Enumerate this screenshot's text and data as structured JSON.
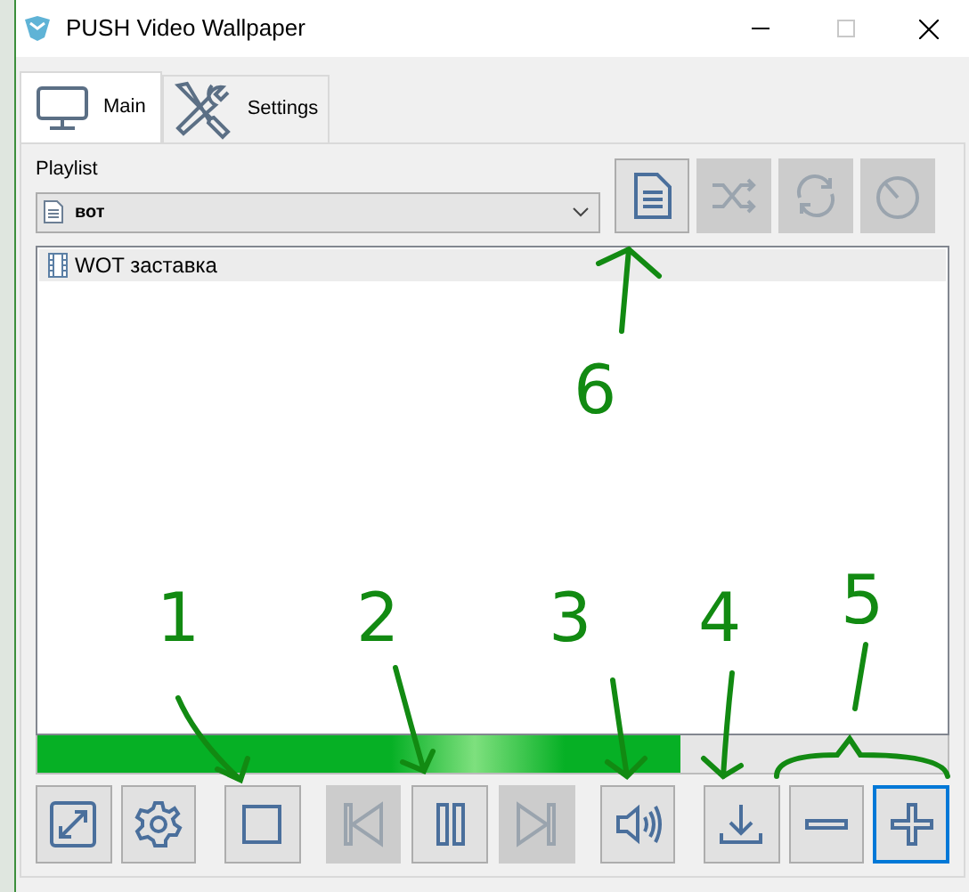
{
  "window": {
    "title": "PUSH Video Wallpaper"
  },
  "tabs": [
    {
      "label": "Main",
      "selected": true
    },
    {
      "label": "Settings",
      "selected": false
    }
  ],
  "playlist": {
    "label": "Playlist",
    "value": "вот"
  },
  "playlist_buttons": [
    {
      "disabled": false
    },
    {
      "disabled": true
    },
    {
      "disabled": true
    },
    {
      "disabled": true
    }
  ],
  "videos": [
    {
      "name": "WOT заставка",
      "selected": true
    }
  ],
  "progress": {
    "level": 0.706
  },
  "controls": [
    {
      "disabled": false,
      "focused": false
    },
    {
      "disabled": false,
      "focused": false
    },
    {
      "disabled": false,
      "focused": false
    },
    {
      "disabled": true,
      "focused": false
    },
    {
      "disabled": false,
      "focused": false
    },
    {
      "disabled": true,
      "focused": false
    },
    {
      "disabled": false,
      "focused": false
    },
    {
      "disabled": false,
      "focused": false
    },
    {
      "disabled": false,
      "focused": false
    },
    {
      "disabled": false,
      "focused": true
    }
  ],
  "annotations": [
    {
      "label": "6"
    },
    {
      "label": "1"
    },
    {
      "label": "2"
    },
    {
      "label": "3"
    },
    {
      "label": "4"
    },
    {
      "label": "5"
    }
  ]
}
